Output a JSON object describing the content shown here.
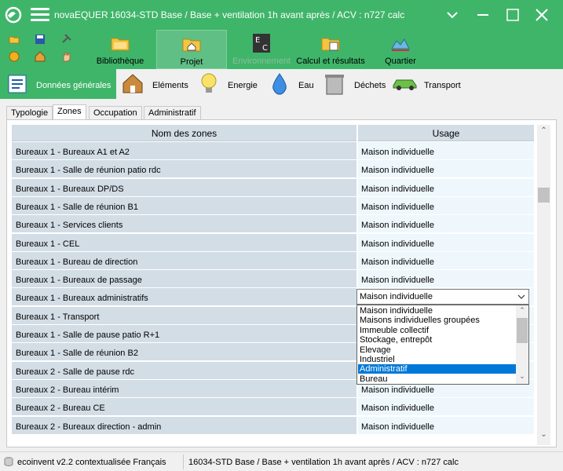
{
  "titlebar": {
    "app_name": "novaEQUER",
    "doc_title": "16034-STD Base / Base + ventilation 1h avant après / ACV : n727 calc"
  },
  "ribbon": {
    "tools": [
      {
        "label": "Bibliothèque",
        "icon": "folder-icon"
      },
      {
        "label": "Projet",
        "icon": "folder-home-icon"
      },
      {
        "label": "Environnement",
        "icon": "ec-icon"
      },
      {
        "label": "Calcul et résultats",
        "icon": "folder-calc-icon"
      },
      {
        "label": "Quartier",
        "icon": "quartier-icon"
      }
    ]
  },
  "subbar": {
    "items": [
      {
        "label": "Données générales"
      },
      {
        "label": "Eléments"
      },
      {
        "label": "Energie"
      },
      {
        "label": "Eau"
      },
      {
        "label": "Déchets"
      },
      {
        "label": "Transport"
      }
    ]
  },
  "tabs": [
    "Typologie",
    "Zones",
    "Occupation",
    "Administratif"
  ],
  "grid": {
    "headers": [
      "Nom des zones",
      "Usage"
    ],
    "rows": [
      {
        "name": "Bureaux 1 - Bureaux A1 et A2",
        "usage": "Maison individuelle"
      },
      {
        "name": "Bureaux 1 - Salle de réunion patio rdc",
        "usage": "Maison individuelle"
      },
      {
        "name": "Bureaux 1 - Bureaux DP/DS",
        "usage": "Maison individuelle"
      },
      {
        "name": "Bureaux 1 - Salle de réunion B1",
        "usage": "Maison individuelle"
      },
      {
        "name": "Bureaux 1 - Services clients",
        "usage": "Maison individuelle"
      },
      {
        "name": "Bureaux 1 - CEL",
        "usage": "Maison individuelle"
      },
      {
        "name": "Bureaux 1 - Bureau de direction",
        "usage": "Maison individuelle"
      },
      {
        "name": "Bureaux 1 - Bureaux de passage",
        "usage": "Maison individuelle"
      },
      {
        "name": "Bureaux 1 - Bureaux administratifs",
        "usage": ""
      },
      {
        "name": "Bureaux 1 - Transport",
        "usage": ""
      },
      {
        "name": "Bureaux 1 - Salle de pause patio R+1",
        "usage": ""
      },
      {
        "name": "Bureaux 1 - Salle de réunion B2",
        "usage": ""
      },
      {
        "name": "Bureaux 2 - Salle de pause rdc",
        "usage": ""
      },
      {
        "name": "Bureaux 2 - Bureau intérim",
        "usage": "Maison individuelle"
      },
      {
        "name": "Bureaux 2 - Bureau CE",
        "usage": "Maison individuelle"
      },
      {
        "name": "Bureaux 2 - Bureaux direction - admin",
        "usage": "Maison individuelle"
      }
    ]
  },
  "combo": {
    "value": "Maison individuelle",
    "options": [
      "Maison individuelle",
      "Maisons individuelles groupées",
      "Immeuble collectif",
      "Stockage, entrepôt",
      "Elevage",
      "Industriel",
      "Administratif",
      "Bureau"
    ],
    "highlighted": "Administratif"
  },
  "status": {
    "database": "ecoinvent v2.2 contextualisée Français",
    "project": "16034-STD Base / Base + ventilation 1h avant après / ACV : n727 calc"
  },
  "colors": {
    "accent": "#3fb56a",
    "selection": "#0078d7",
    "row_name_bg": "#d3dde6",
    "row_usage_bg": "#eef7fc"
  }
}
